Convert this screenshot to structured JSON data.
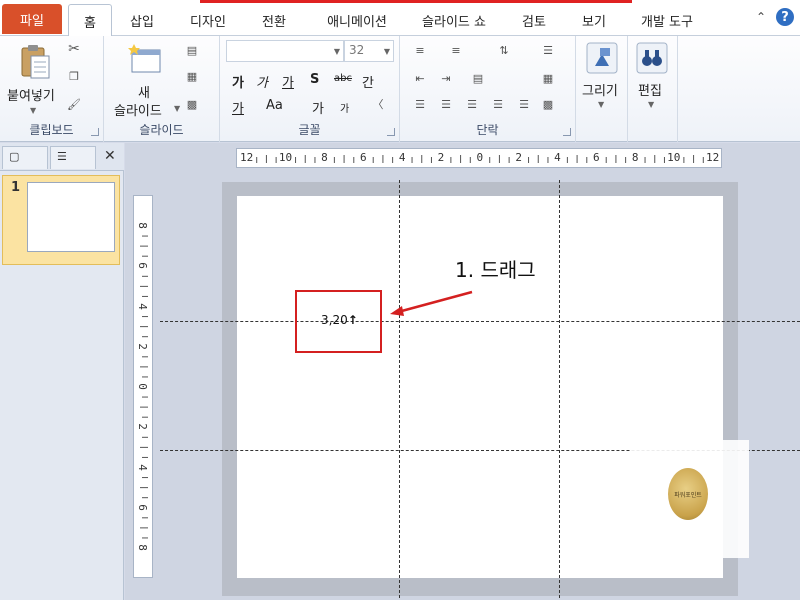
{
  "tabs": {
    "file": "파일",
    "items": [
      "홈",
      "삽입",
      "디자인",
      "전환",
      "애니메이션",
      "슬라이드 쇼",
      "검토",
      "보기",
      "개발 도구"
    ],
    "active_index": 0
  },
  "ribbon": {
    "clipboard": {
      "label": "클립보드",
      "paste": "붙여넣기"
    },
    "slides": {
      "label": "슬라이드",
      "new_slide_line1": "새",
      "new_slide_line2": "슬라이드"
    },
    "font": {
      "label": "글꼴",
      "size": "32",
      "row2": [
        "가",
        "가",
        "가",
        "S",
        "abc",
        "간"
      ],
      "row3": [
        "가",
        "Aa",
        "가",
        "가"
      ]
    },
    "paragraph": {
      "label": "단락"
    },
    "drawing": {
      "label": "그리기"
    },
    "editing": {
      "label": "편집"
    }
  },
  "thumbnails": {
    "slide_number": "1"
  },
  "rulers": {
    "horizontal": [
      "12",
      "10",
      "8",
      "6",
      "4",
      "2",
      "0",
      "2",
      "4",
      "6",
      "8",
      "10",
      "12"
    ],
    "vertical": [
      "8",
      "6",
      "4",
      "2",
      "0",
      "2",
      "4",
      "6",
      "8"
    ]
  },
  "slide": {
    "guide_value": "3,20",
    "annotation": "1. 드래그",
    "stamp_text": "파워포인트"
  },
  "colors": {
    "file_tab": "#d9502a",
    "annotation_red": "#d42020"
  }
}
